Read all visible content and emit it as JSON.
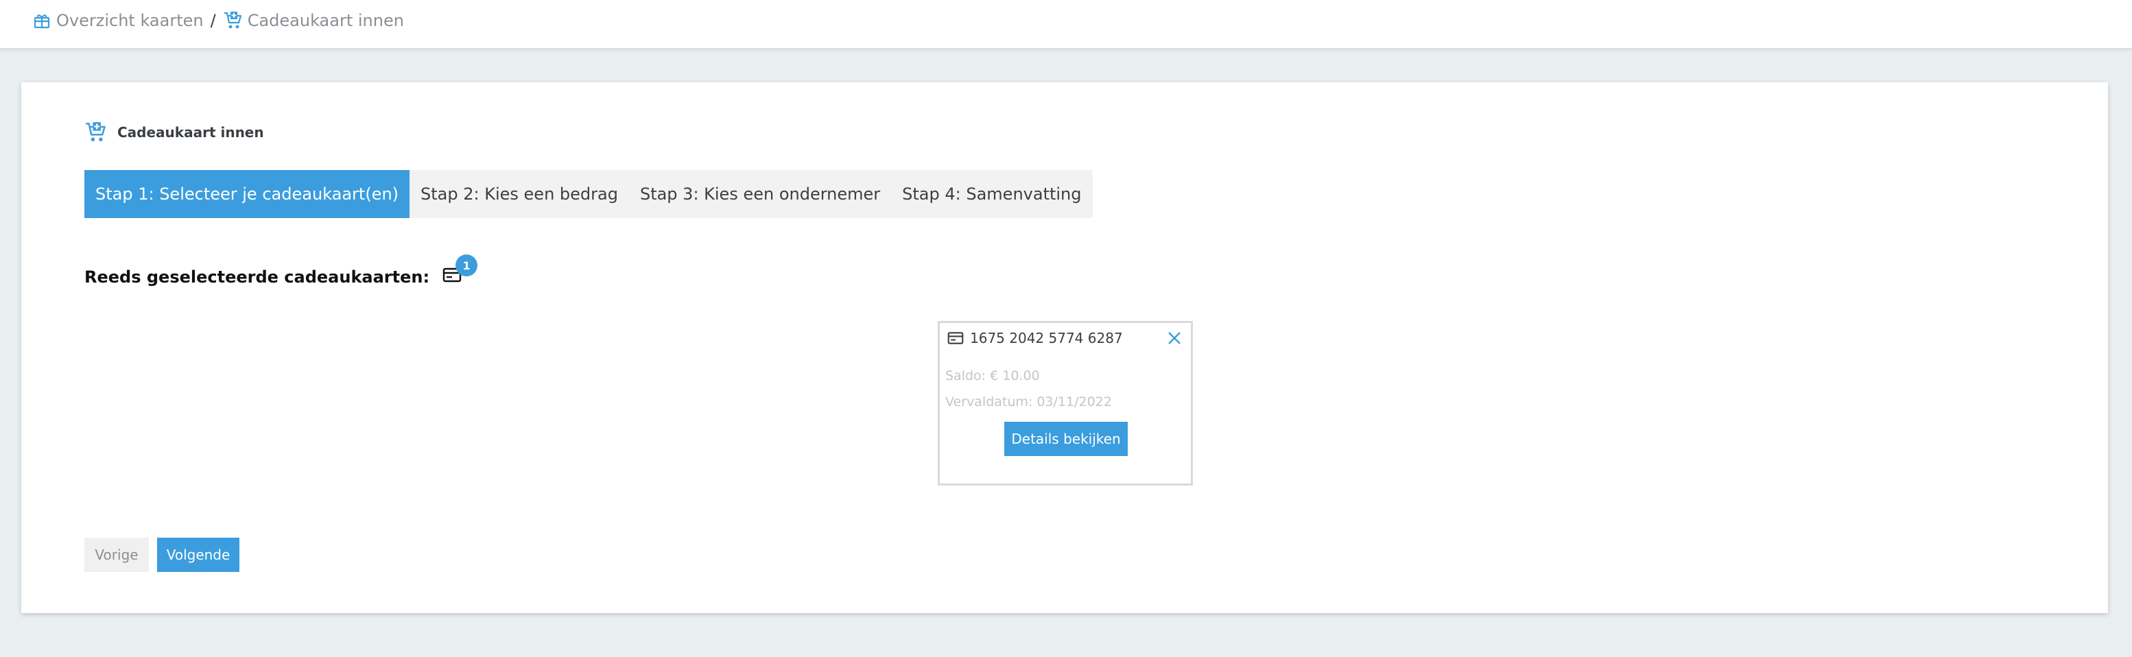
{
  "breadcrumb": {
    "items": [
      {
        "label": "Overzicht kaarten",
        "icon": "gift-icon"
      },
      {
        "label": "Cadeaukaart innen",
        "icon": "cart-plus-icon"
      }
    ],
    "separator": "/"
  },
  "page": {
    "title": "Cadeaukaart innen",
    "title_icon": "cart-plus-icon"
  },
  "steps": [
    {
      "label": "Stap 1: Selecteer je cadeaukaart(en)",
      "active": true
    },
    {
      "label": "Stap 2: Kies een bedrag",
      "active": false
    },
    {
      "label": "Stap 3: Kies een ondernemer",
      "active": false
    },
    {
      "label": "Stap 4: Samenvatting",
      "active": false
    }
  ],
  "selected": {
    "label": "Reeds geselecteerde cadeaukaarten:",
    "count": "1",
    "icon": "credit-card-icon"
  },
  "giftcard": {
    "number": "1675 2042 5774 6287",
    "balance": "Saldo: € 10.00",
    "expiry": "Vervaldatum: 03/11/2022",
    "details_label": "Details bekijken"
  },
  "nav": {
    "prev_label": "Vorige",
    "next_label": "Volgende"
  },
  "colors": {
    "accent": "#3b9ddd",
    "background": "#e9eef1",
    "muted_text": "#8a8f94"
  }
}
